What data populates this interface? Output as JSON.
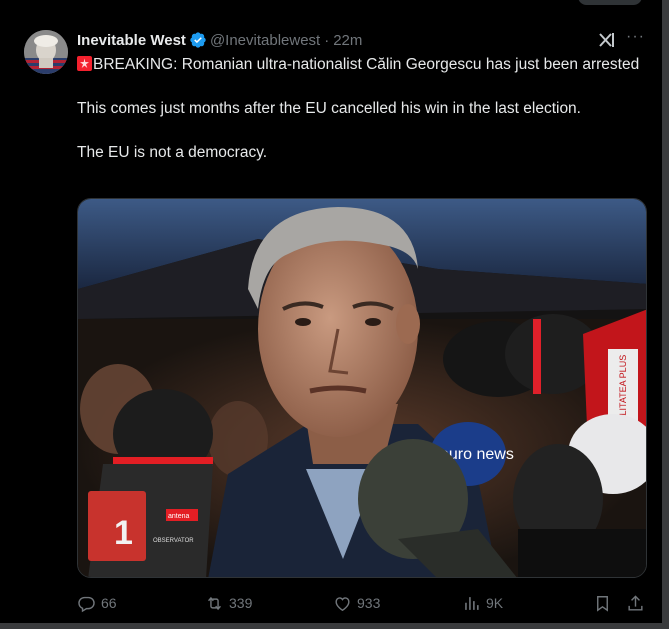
{
  "tweet": {
    "display_name": "Inevitable West",
    "handle": "@Inevitablewest",
    "separator": "·",
    "time": "22m",
    "more_label": "···",
    "text": {
      "line1": "BREAKING: Romanian ultra-nationalist Călin Georgescu has just been arrested",
      "line2": "This comes just months after the EU cancelled his win in the last election.",
      "line3": "The EU is not a democracy."
    },
    "media": {
      "mic_brand_euronews": "euro news",
      "mic_brand_antena": "antena",
      "mic_brand_observator": "OBSERVATOR",
      "mic_brand_realitatea": "REALITATEA PLUS"
    },
    "actions": {
      "replies": "66",
      "reposts": "339",
      "likes": "933",
      "views": "9K"
    }
  },
  "colors": {
    "background": "#000000",
    "text": "#e7e9ea",
    "muted": "#71767b",
    "verified": "#1d9bf0",
    "siren": "#f4212e"
  },
  "icons": [
    "verified-badge-icon",
    "grok-icon",
    "more-icon",
    "siren-icon",
    "reply-icon",
    "repost-icon",
    "like-icon",
    "views-icon",
    "bookmark-icon",
    "share-icon"
  ]
}
